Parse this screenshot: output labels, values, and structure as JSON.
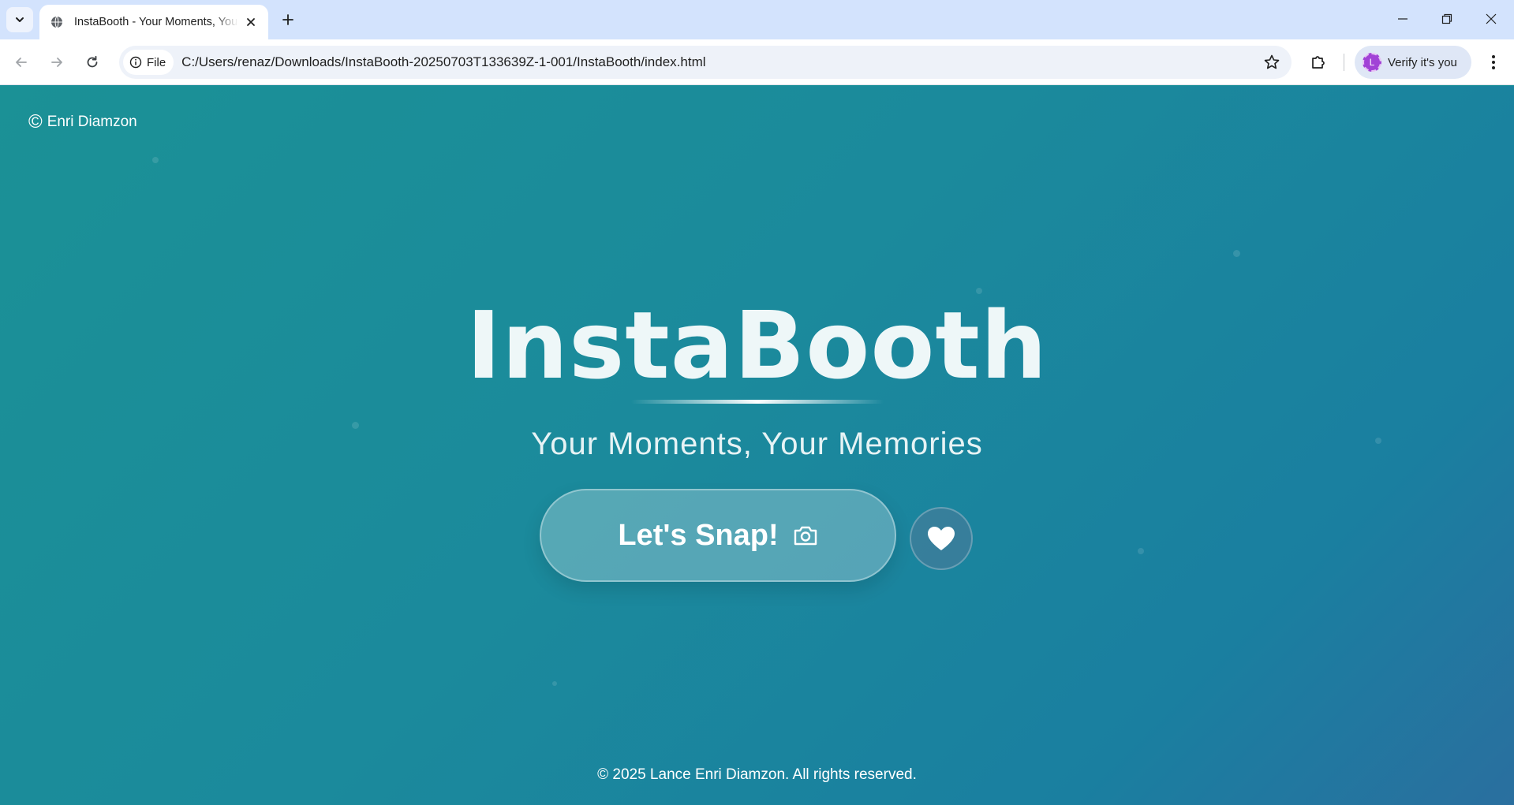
{
  "browser": {
    "tab_title": "InstaBooth - Your Moments, Your Memories",
    "tab_favicon": "globe-icon",
    "chip_label": "File",
    "url": "C:/Users/renaz/Downloads/InstaBooth-20250703T133639Z-1-001/InstaBooth/index.html",
    "profile_initial": "L",
    "profile_label": "Verify it's you"
  },
  "page": {
    "credit": "Enri Diamzon",
    "credit_symbol": "©",
    "title": "InstaBooth",
    "subtitle": "Your Moments, Your Memories",
    "snap_button": "Let's Snap!",
    "footer": "© 2025 Lance Enri Diamzon. All rights reserved."
  },
  "colors": {
    "background_start": "#1b9196",
    "background_end": "#2a6f9f",
    "tabstrip": "#d3e3fd",
    "accent_avatar": "#a142d6"
  }
}
